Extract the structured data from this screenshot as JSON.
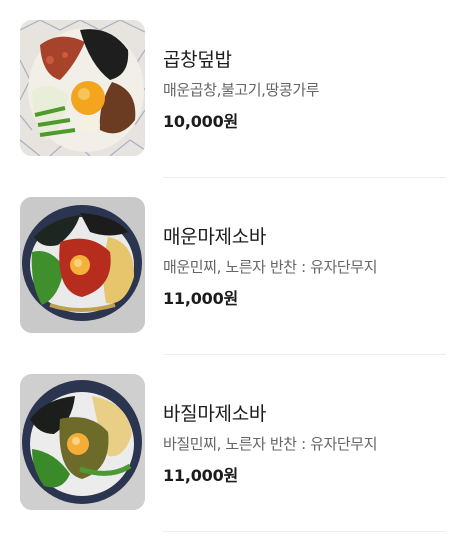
{
  "menu": {
    "items": [
      {
        "name": "곱창덮밥",
        "description": "매운곱창,불고기,땅콩가루",
        "price": "10,000원",
        "image": "gopchang-rice-bowl-photo"
      },
      {
        "name": "매운마제소바",
        "description": "매운민찌, 노른자 반찬 : 유자단무지",
        "price": "11,000원",
        "image": "spicy-mazesoba-photo"
      },
      {
        "name": "바질마제소바",
        "description": "바질민찌, 노른자 반찬 : 유자단무지",
        "price": "11,000원",
        "image": "basil-mazesoba-photo"
      }
    ]
  }
}
